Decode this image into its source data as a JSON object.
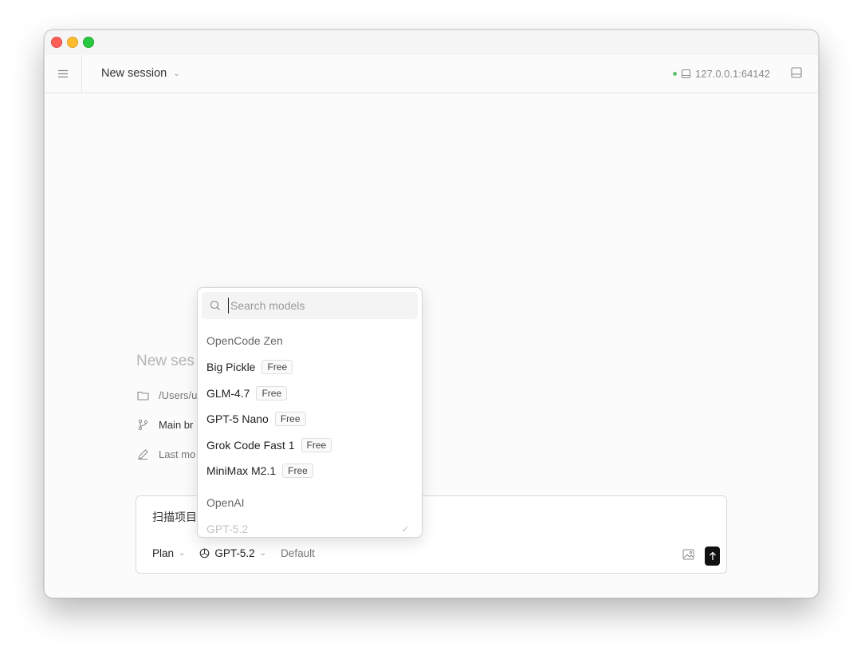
{
  "header": {
    "session_title": "New session",
    "server_address": "127.0.0.1:64142"
  },
  "intro": {
    "title": "New ses",
    "path": "/Users/u",
    "branch": "Main br",
    "last_modified": "Last mo"
  },
  "composer": {
    "text": "扫描项目",
    "mode_label": "Plan",
    "model_label": "GPT-5.2",
    "variant_label": "Default"
  },
  "model_picker": {
    "search_placeholder": "Search models",
    "groups": [
      {
        "label": "OpenCode Zen",
        "items": [
          {
            "name": "Big Pickle",
            "badge": "Free"
          },
          {
            "name": "GLM-4.7",
            "badge": "Free"
          },
          {
            "name": "GPT-5 Nano",
            "badge": "Free"
          },
          {
            "name": "Grok Code Fast 1",
            "badge": "Free"
          },
          {
            "name": "MiniMax M2.1",
            "badge": "Free"
          }
        ]
      },
      {
        "label": "OpenAI",
        "items": [
          {
            "name": "GPT-5.2",
            "badge": ""
          }
        ]
      }
    ]
  },
  "colors": {
    "status_online": "#5cc36b",
    "send_button": "#111111"
  }
}
